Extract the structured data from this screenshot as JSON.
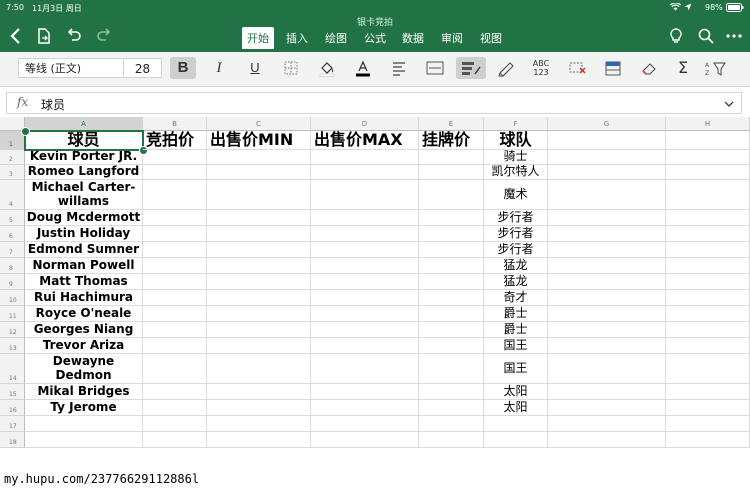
{
  "status": {
    "time": "7:50",
    "date": "11月3日 周日",
    "battery": "98%"
  },
  "title": "银卡竞拍",
  "tabs": [
    {
      "label": "开始",
      "active": true
    },
    {
      "label": "插入",
      "active": false
    },
    {
      "label": "绘图",
      "active": false
    },
    {
      "label": "公式",
      "active": false
    },
    {
      "label": "数据",
      "active": false
    },
    {
      "label": "审阅",
      "active": false
    },
    {
      "label": "视图",
      "active": false
    }
  ],
  "ribbon": {
    "font_name": "等线 (正文)",
    "font_size": "28",
    "bold": "B",
    "italic": "I",
    "underline": "U",
    "abc_top": "ABC",
    "abc_bottom": "123",
    "sum": "Σ"
  },
  "formula_bar": {
    "fx": "fx",
    "value": "球员"
  },
  "columns": [
    "A",
    "B",
    "C",
    "D",
    "E",
    "F",
    "G",
    "H"
  ],
  "rows": [
    "1",
    "2",
    "3",
    "4",
    "5",
    "6",
    "7",
    "8",
    "9",
    "10",
    "11",
    "12",
    "13",
    "14",
    "15",
    "16",
    "17",
    "18"
  ],
  "sheet": {
    "headers": [
      "球员",
      "竞拍价",
      "出售价MIN",
      "出售价MAX",
      "挂牌价",
      "球队"
    ],
    "players": [
      {
        "name": "Kevin Porter JR.",
        "team": "骑士"
      },
      {
        "name": "Romeo Langford",
        "team": "凯尔特人"
      },
      {
        "name": "Michael Carter-willams",
        "team": "魔术"
      },
      {
        "name": "Doug Mcdermott",
        "team": "步行者"
      },
      {
        "name": "Justin Holiday",
        "team": "步行者"
      },
      {
        "name": "Edmond Sumner",
        "team": "步行者"
      },
      {
        "name": "Norman Powell",
        "team": "猛龙"
      },
      {
        "name": "Matt Thomas",
        "team": "猛龙"
      },
      {
        "name": "Rui Hachimura",
        "team": "奇才"
      },
      {
        "name": "Royce O'neale",
        "team": "爵士"
      },
      {
        "name": "Georges Niang",
        "team": "爵士"
      },
      {
        "name": "Trevor Ariza",
        "team": "国王"
      },
      {
        "name": "Dewayne Dedmon",
        "team": "国王"
      },
      {
        "name": "Mikal Bridges",
        "team": "太阳"
      },
      {
        "name": "Ty Jerome",
        "team": "太阳"
      }
    ]
  },
  "watermark": "my.hupu.com/23776629112886l",
  "colors": {
    "accent": "#217346"
  }
}
